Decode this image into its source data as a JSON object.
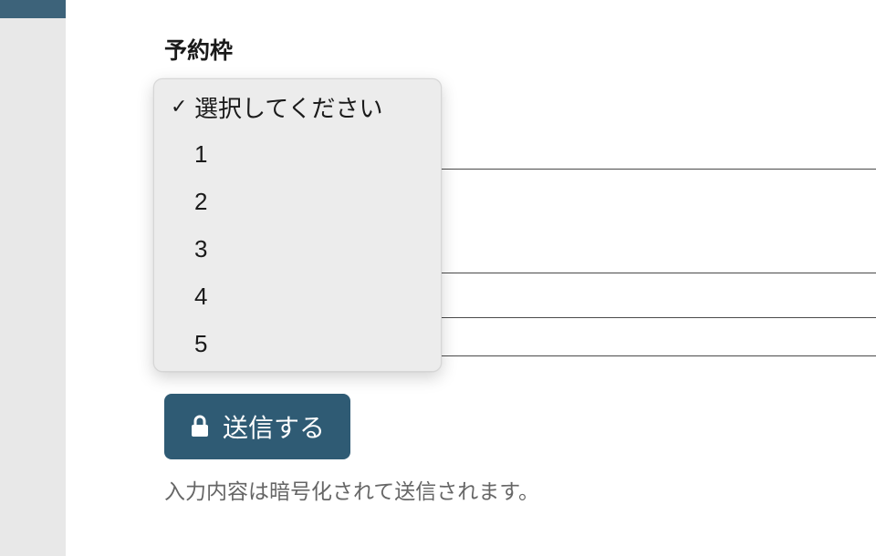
{
  "form": {
    "field_label": "予約枠",
    "dropdown": {
      "placeholder": "選択してください",
      "options": [
        "1",
        "2",
        "3",
        "4",
        "5"
      ],
      "selected_index": -1
    },
    "submit_label": "送信する",
    "notice": "入力内容は暗号化されて送信されます。"
  },
  "icons": {
    "check": "✓",
    "lock": "lock-icon"
  }
}
